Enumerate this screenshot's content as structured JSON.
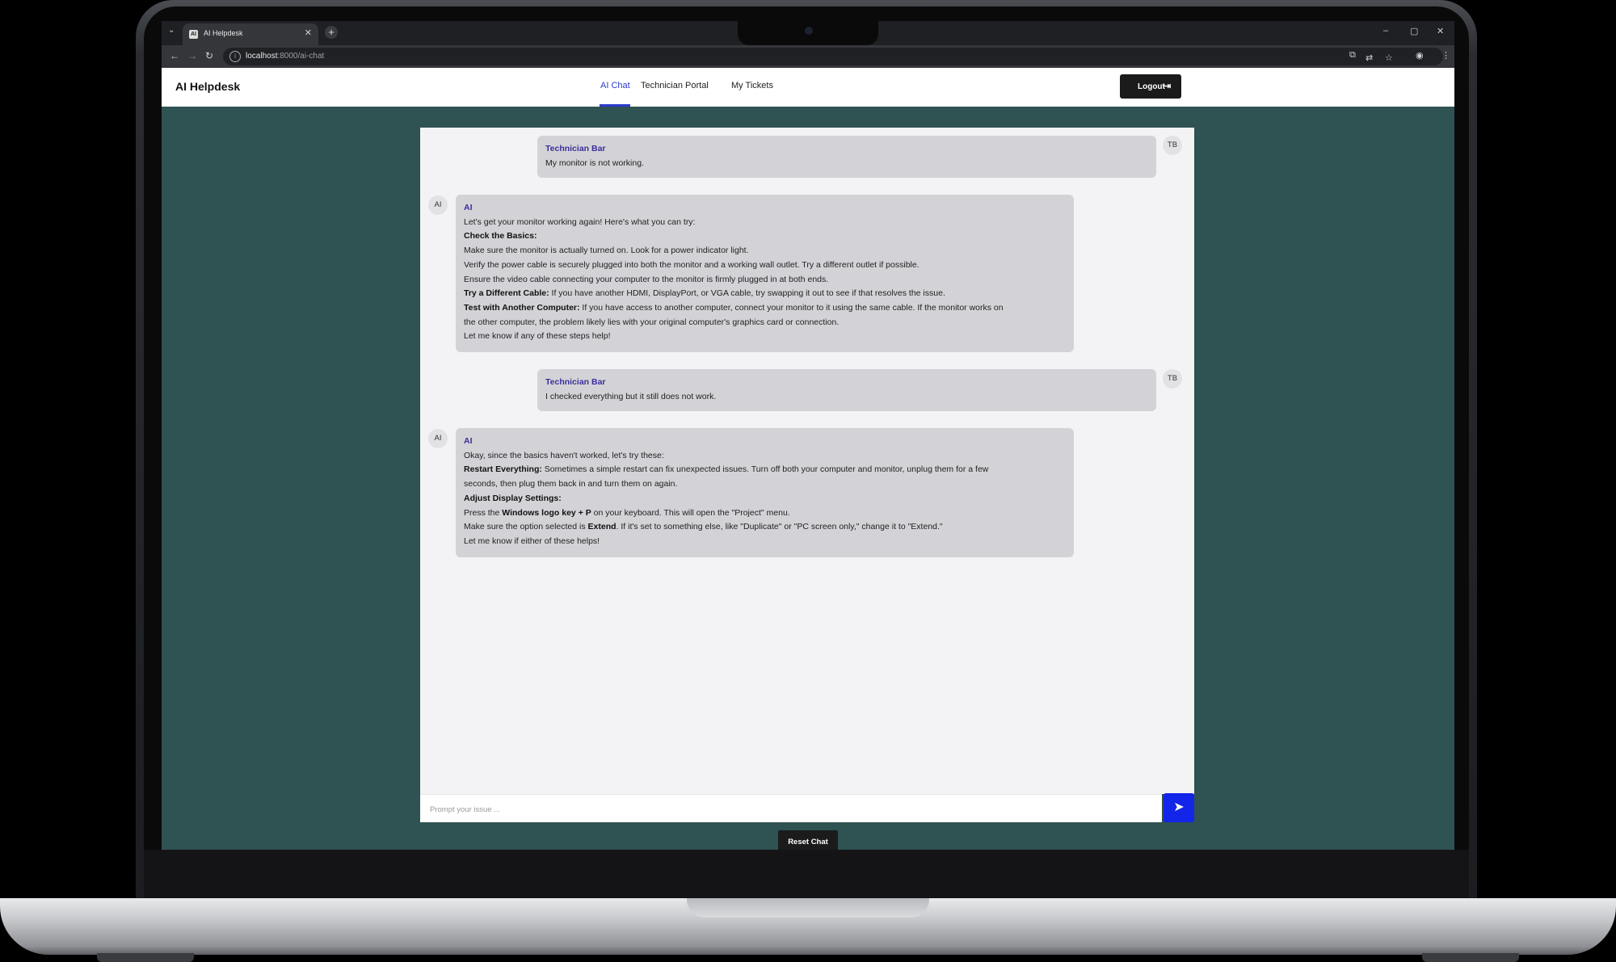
{
  "browser": {
    "tab_favicon": "AI",
    "tab_title": "AI Helpdesk",
    "url_host": "localhost",
    "url_path": ":8000/ai-chat"
  },
  "app": {
    "brand": "AI Helpdesk",
    "nav": [
      {
        "label": "AI Chat",
        "active": true
      },
      {
        "label": "Technician Portal",
        "active": false
      },
      {
        "label": "My Tickets",
        "active": false
      }
    ],
    "logout_label": "Logout"
  },
  "chat": {
    "messages": [
      {
        "role": "user",
        "avatar": "TB",
        "sender": "Technician Bar",
        "lines": [
          "My monitor is not working."
        ]
      },
      {
        "role": "ai",
        "avatar": "AI",
        "sender": "AI",
        "lines": [
          {
            "text": "Let's get your monitor working again! Here's what you can try:"
          },
          {
            "bold": "Check the Basics:"
          },
          {
            "text": "Make sure the monitor is actually turned on. Look for a power indicator light."
          },
          {
            "text": "Verify the power cable is securely plugged into both the monitor and a working wall outlet. Try a different outlet if possible."
          },
          {
            "text": "Ensure the video cable connecting your computer to the monitor is firmly plugged in at both ends."
          },
          {
            "bold": "Try a Different Cable:",
            "text": " If you have another HDMI, DisplayPort, or VGA cable, try swapping it out to see if that resolves the issue."
          },
          {
            "bold": "Test with Another Computer:",
            "text": " If you have access to another computer, connect your monitor to it using the same cable. If the monitor works on"
          },
          {
            "text": "the other computer, the problem likely lies with your original computer's graphics card or connection."
          },
          {
            "text": "Let me know if any of these steps help!"
          }
        ]
      },
      {
        "role": "user",
        "avatar": "TB",
        "sender": "Technician Bar",
        "lines": [
          "I checked everything but it still does not work."
        ]
      },
      {
        "role": "ai",
        "avatar": "AI",
        "sender": "AI",
        "lines": [
          {
            "text": "Okay, since the basics haven't worked, let's try these:"
          },
          {
            "bold": "Restart Everything:",
            "text": " Sometimes a simple restart can fix unexpected issues. Turn off both your computer and monitor, unplug them for a few"
          },
          {
            "text": "seconds, then plug them back in and turn them on again."
          },
          {
            "bold": "Adjust Display Settings:"
          },
          {
            "text": "Press the ",
            "bold2": "Windows logo key + P",
            "text2": " on your keyboard. This will open the \"Project\" menu."
          },
          {
            "text": "Make sure the option selected is ",
            "bold2": "Extend",
            "text2": ". If it's set to something else, like \"Duplicate\" or \"PC screen only,\" change it to \"Extend.\""
          },
          {
            "text": "Let me know if either of these helps!"
          }
        ]
      }
    ],
    "input_placeholder": "Prompt your issue ...",
    "reset_label": "Reset Chat"
  },
  "colors": {
    "page_bg": "#2f5252",
    "accent": "#2b3bcf",
    "send_button": "#1325e8",
    "sender_name": "#3b2f9b"
  }
}
